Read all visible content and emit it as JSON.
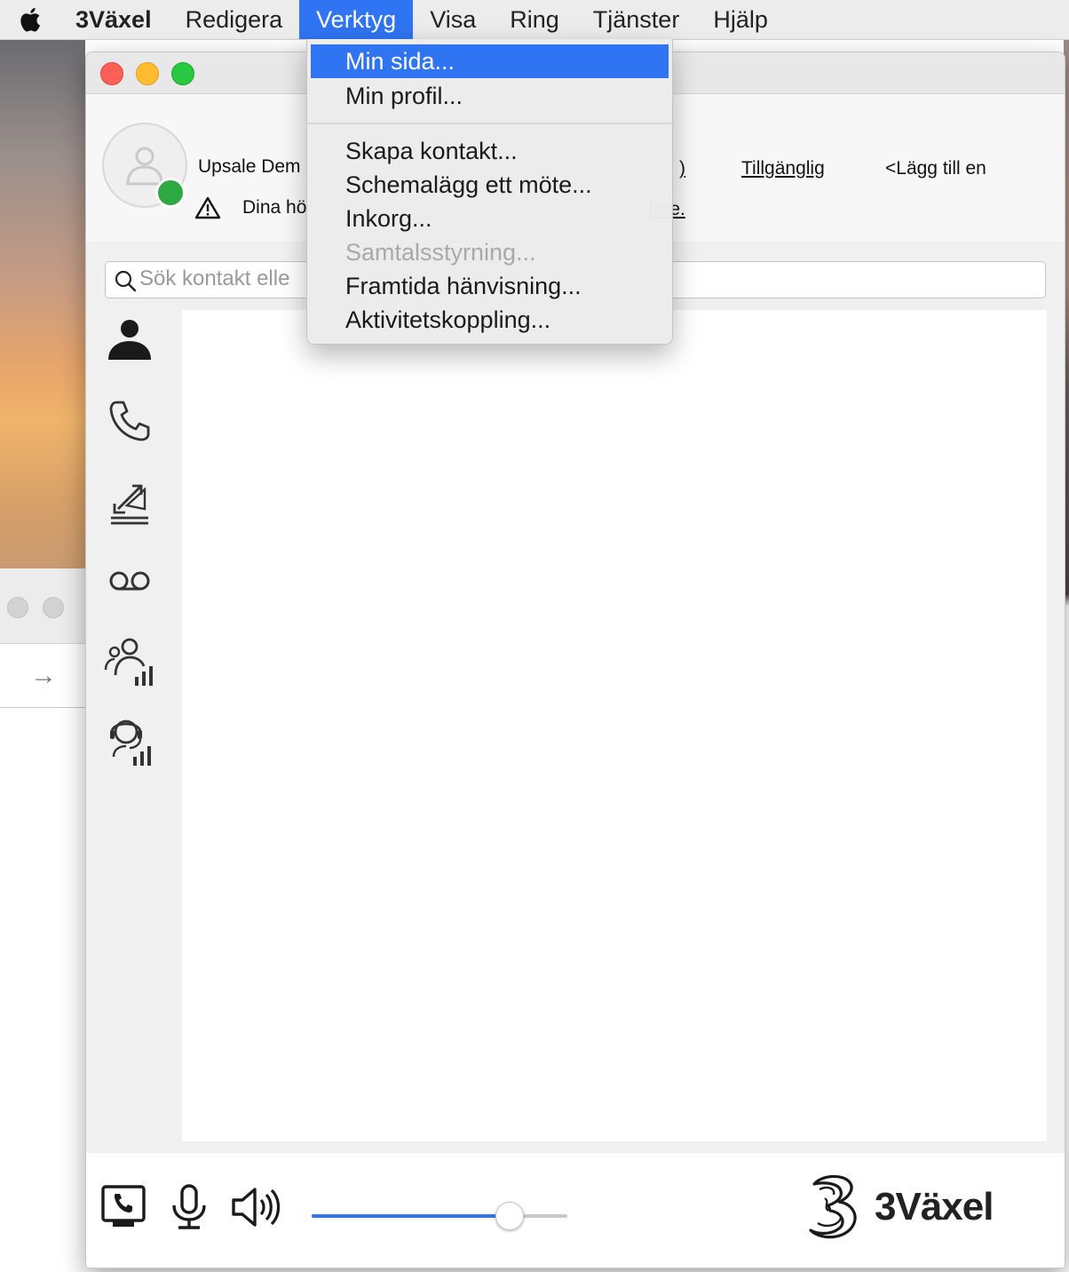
{
  "menubar": {
    "apple": "apple-icon",
    "items": [
      "3Växel",
      "Redigera",
      "Verktyg",
      "Visa",
      "Ring",
      "Tjänster",
      "Hjälp"
    ],
    "active": "Verktyg"
  },
  "dropdown": {
    "items": [
      {
        "label": "Min sida...",
        "state": "selected"
      },
      {
        "label": "Min profil...",
        "state": "enabled"
      },
      {
        "label": "Skapa kontakt...",
        "state": "enabled"
      },
      {
        "label": "Schemalägg ett möte...",
        "state": "enabled"
      },
      {
        "label": "Inkorg...",
        "state": "enabled"
      },
      {
        "label": "Samtalsstyrning...",
        "state": "disabled"
      },
      {
        "label": "Framtida hänvisning...",
        "state": "enabled"
      },
      {
        "label": "Aktivitetskoppling...",
        "state": "enabled"
      }
    ]
  },
  "header": {
    "name": "Upsale Dem",
    "warning": "Dina hö",
    "status_fragment": ")",
    "availability": "Tillgänglig",
    "add_note": "<Lägg till en",
    "link_fragment": "lare."
  },
  "search": {
    "placeholder": "Sök kontakt elle"
  },
  "sidenav": {
    "items": [
      "contacts-icon",
      "phone-icon",
      "call-transfer-icon",
      "voicemail-icon",
      "group-stats-icon",
      "queue-stats-icon"
    ]
  },
  "footer": {
    "volume_percent": 77,
    "brand": "3Växel"
  },
  "colors": {
    "accent": "#2f74f2",
    "presence": "#2ea843"
  }
}
